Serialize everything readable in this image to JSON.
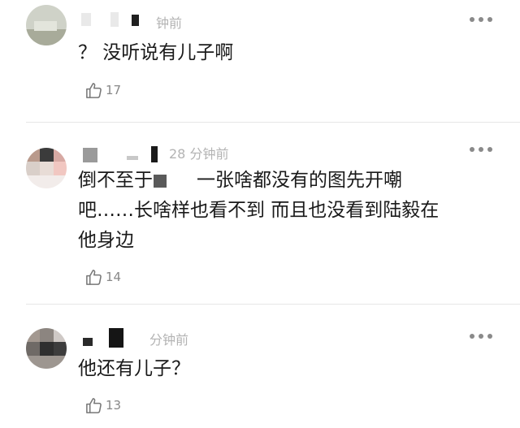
{
  "comments": [
    {
      "time": "钟前",
      "lines": [
        "？ 没听说有儿子啊"
      ],
      "likes": "17"
    },
    {
      "time": "28 分钟前",
      "line1_a": "倒不至于",
      "line1_b": "一张啥都没有的图先开嘲",
      "line2": "吧……长啥样也看不到 而且也没看到陆毅在",
      "line3": "他身边",
      "likes": "14"
    },
    {
      "time": "分钟前",
      "lines": [
        "他还有儿子？"
      ],
      "likes": "13"
    }
  ],
  "icons": {
    "like": "thumbs-up-icon",
    "more": "more-dots-icon"
  },
  "colors": {
    "text": "#1a1a1a",
    "meta": "#b3b3b3",
    "count": "#888888",
    "divider": "#e6e6e6"
  }
}
